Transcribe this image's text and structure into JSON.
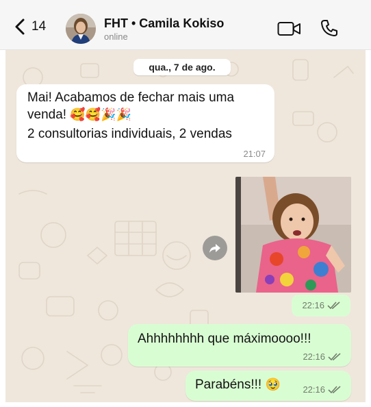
{
  "header": {
    "back_count": "14",
    "contact_name": "FHT • Camila Kokiso",
    "status": "online"
  },
  "chat": {
    "date_separator": "qua., 7 de ago.",
    "incoming": {
      "line1": "Mai! Acabamos de fechar mais uma",
      "line2_text": "venda! ",
      "line2_emoji": "🥰🥰🎉🎉",
      "line3": "2 consultorias individuais, 2 vendas",
      "time": "21:07"
    },
    "photo_message": {
      "time": "22:16"
    },
    "outgoing": [
      {
        "text": "Ahhhhhhhh que máximoooo!!!",
        "time": "22:16"
      },
      {
        "text": "Parabéns!!! ",
        "emoji": "🥹",
        "time": "22:16"
      }
    ]
  },
  "colors": {
    "incoming_bubble": "#ffffff",
    "outgoing_bubble": "#d9fdd3",
    "wallpaper": "#efe7dc",
    "read_ticks": "#6f7d6a"
  },
  "icons": [
    "chevron-left-icon",
    "video-camera-icon",
    "phone-icon",
    "forward-icon",
    "double-check-icon"
  ]
}
